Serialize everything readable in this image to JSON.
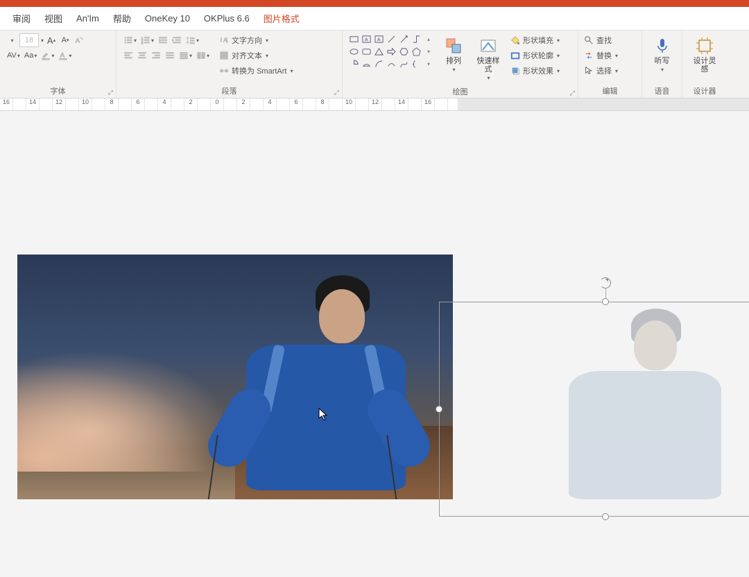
{
  "tabs": {
    "review": "审阅",
    "view": "视图",
    "anim": "An'Im",
    "help": "帮助",
    "onekey": "OneKey 10",
    "okplus": "OKPlus 6.6",
    "picture_format": "图片格式"
  },
  "font": {
    "size": "18",
    "group_label": "字体"
  },
  "paragraph": {
    "group_label": "段落",
    "text_direction": "文字方向",
    "align_text": "对齐文本",
    "smartart": "转换为 SmartArt"
  },
  "drawing": {
    "group_label": "绘图",
    "arrange": "排列",
    "quick_styles": "快速样式",
    "shape_fill": "形状填充",
    "shape_outline": "形状轮廓",
    "shape_effects": "形状效果"
  },
  "editing": {
    "group_label": "编辑",
    "find": "查找",
    "replace": "替换",
    "select": "选择"
  },
  "voice": {
    "group_label": "语音",
    "dictate": "听写"
  },
  "designer": {
    "group_label": "设计器",
    "design_ideas": "设计灵感"
  },
  "ruler": {
    "ticks": [
      "16",
      "",
      "14",
      "",
      "12",
      "",
      "10",
      "",
      "8",
      "",
      "6",
      "",
      "4",
      "",
      "2",
      "",
      "0",
      "",
      "2",
      "",
      "4",
      "",
      "6",
      "",
      "8",
      "",
      "10",
      "",
      "12",
      "",
      "14",
      "",
      "16",
      ""
    ]
  }
}
